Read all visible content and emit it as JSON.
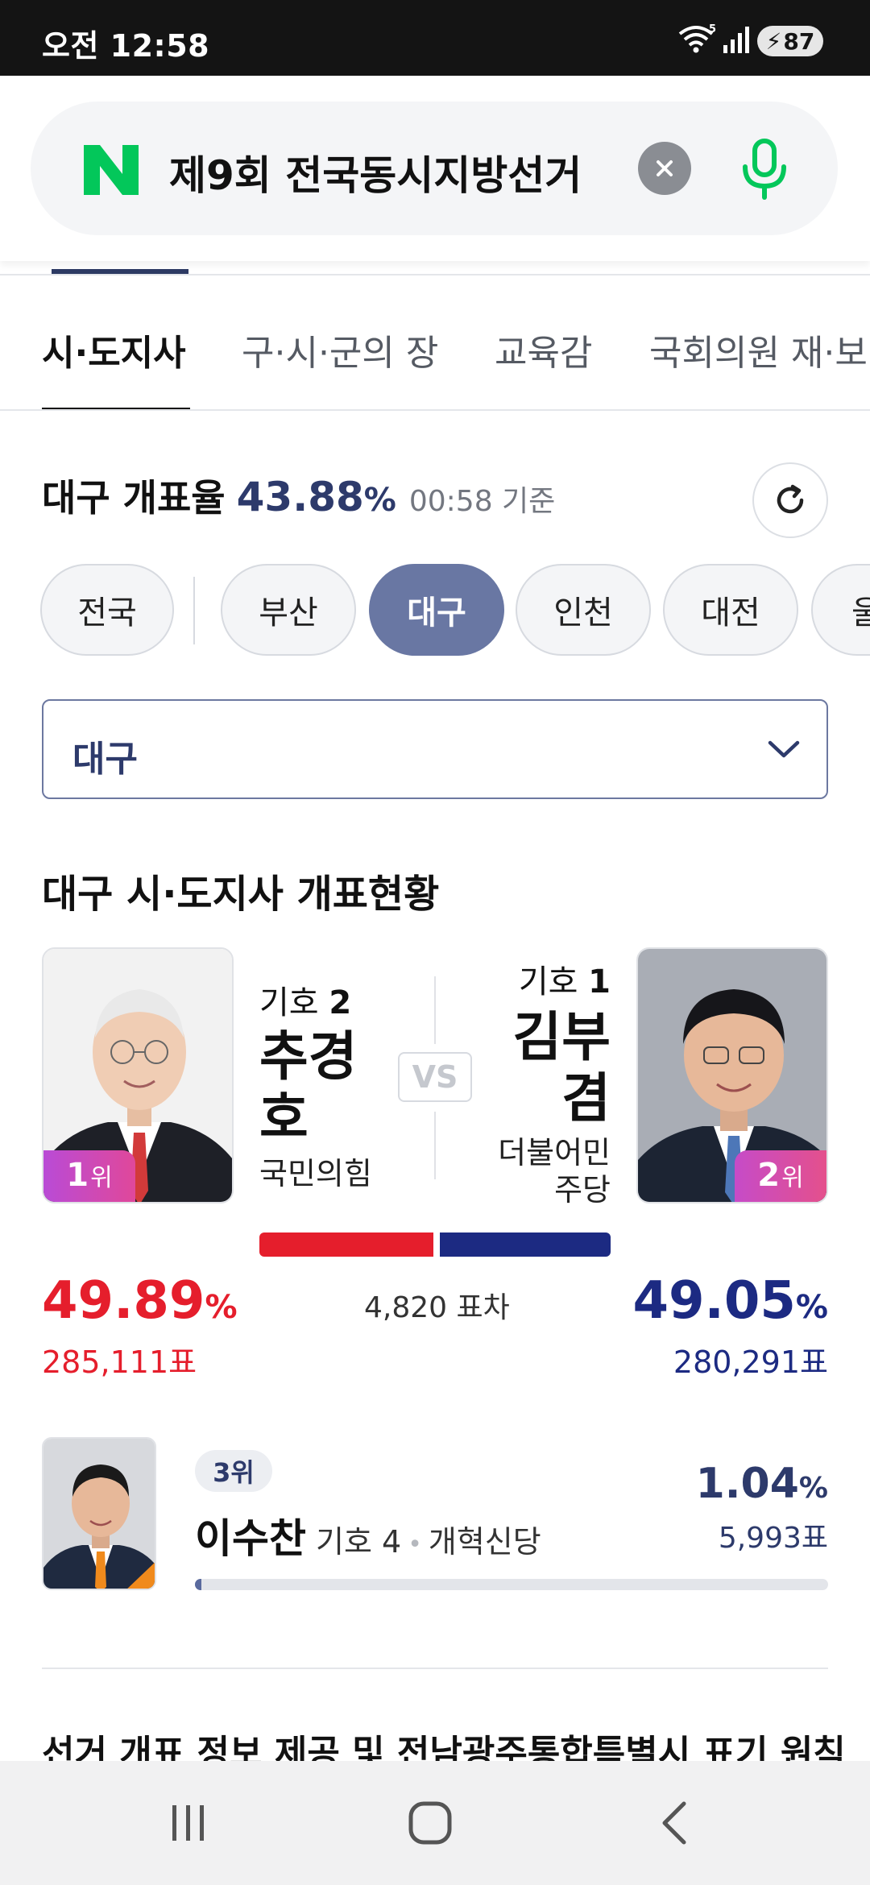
{
  "status_bar": {
    "time": "오전 12:58",
    "wifi_badge": "5",
    "battery": "87",
    "icons": [
      "wifi-icon",
      "signal-icon",
      "battery-charging-icon"
    ]
  },
  "search": {
    "logo": "N",
    "query": "제9회 전국동시지방선거",
    "brand_color": "#03c75a",
    "icons": [
      "naver-logo-icon",
      "clear-icon",
      "microphone-icon"
    ]
  },
  "tabs": [
    {
      "label": "시·도지사",
      "active": true
    },
    {
      "label": "구·시·군의 장",
      "active": false
    },
    {
      "label": "교육감",
      "active": false
    },
    {
      "label": "국회의원 재·보"
    }
  ],
  "rate": {
    "label": "대구 개표율",
    "value": "43.88",
    "unit": "%",
    "time": "00:58 기준",
    "icon": "refresh-icon"
  },
  "regions": [
    {
      "label": "전국",
      "active": false
    },
    {
      "label": "부산",
      "active": false
    },
    {
      "label": "대구",
      "active": true
    },
    {
      "label": "인천",
      "active": false
    },
    {
      "label": "대전",
      "active": false
    },
    {
      "label": "울",
      "active": false
    }
  ],
  "region_select": {
    "value": "대구",
    "icon": "chevron-down-icon"
  },
  "section_title": "대구 시·도지사 개표현황",
  "matchup": {
    "vs": "VS",
    "gap": "4,820 표차",
    "left": {
      "rank": "1",
      "rank_unit": "위",
      "ballot_label": "기호",
      "ballot_number": "2",
      "name_lines": [
        "추경",
        "호"
      ],
      "party": "국민의힘",
      "percent": "49.89",
      "percent_unit": "%",
      "votes": "285,111표",
      "share": 49.89,
      "color": "#e51e2c"
    },
    "right": {
      "rank": "2",
      "rank_unit": "위",
      "ballot_label": "기호",
      "ballot_number": "1",
      "name_lines": [
        "김부",
        "겸"
      ],
      "party_lines": [
        "더불어민",
        "주당"
      ],
      "percent": "49.05",
      "percent_unit": "%",
      "votes": "280,291표",
      "share": 49.05,
      "color": "#1c2a82"
    }
  },
  "third": {
    "rank": "3위",
    "name": "이수찬",
    "ballot": "기호 4",
    "party": "개혁신당",
    "percent": "1.04",
    "percent_unit": "%",
    "votes": "5,993표",
    "share": 1.04
  },
  "notice": "선거 개표 정보 제공 및 전남광주통합특별시 표기 원칙",
  "nav": [
    "recents-icon",
    "home-icon",
    "back-icon"
  ]
}
